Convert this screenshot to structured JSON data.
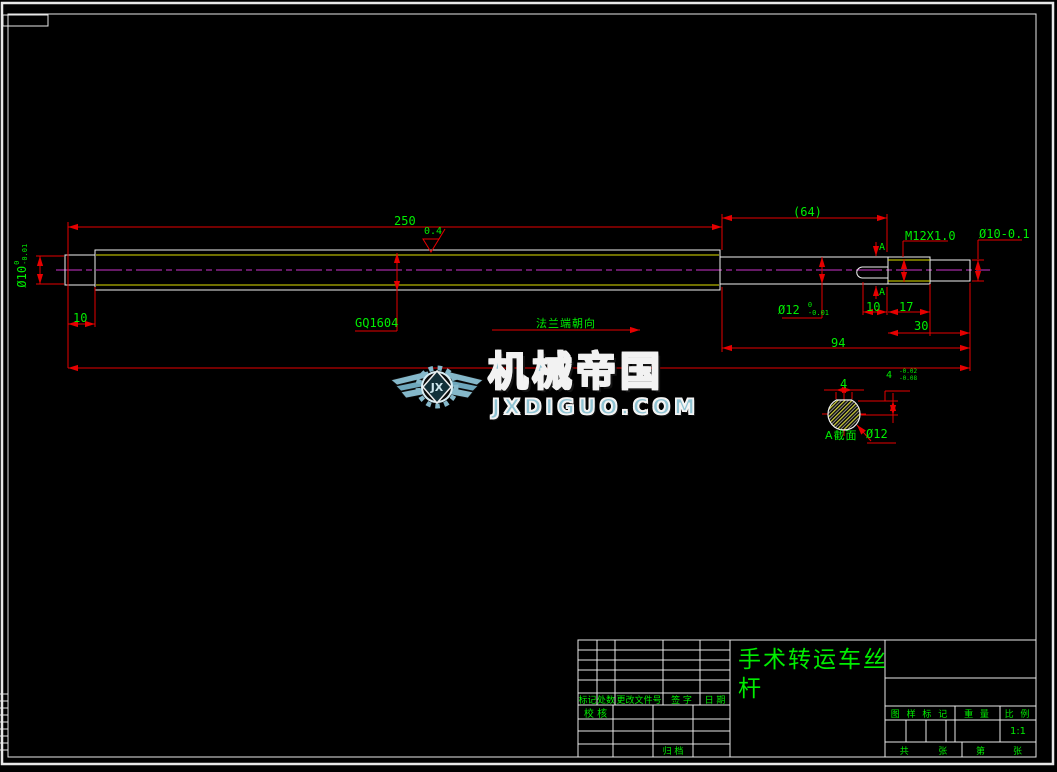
{
  "dims": {
    "len_250": "250",
    "len_64": "(64)",
    "roughness": "0.4",
    "thread": "M12X1.0",
    "dia10_end": "Ø10-0.1",
    "dia10_left": {
      "base": "Ø10",
      "upper": "0",
      "lower": "-0.01"
    },
    "dia12": {
      "base": "Ø12",
      "upper": "0",
      "lower": "-0.01"
    },
    "len_10_left": "10",
    "len_10_flat": "10",
    "len_17": "17",
    "len_30": "30",
    "len_94": "94",
    "screw_spec": "GQ1604",
    "flange_note": "法兰端朝向",
    "section_mark": "A",
    "flat_width": "4",
    "flat_tol": {
      "base": "4",
      "upper": "-0.02",
      "lower": "-0.08"
    },
    "section_name": "A截面",
    "section_dia": "Ø12"
  },
  "watermark": {
    "brand": "机械帝国",
    "site": "JXDIGUO.COM",
    "logo_initials": "JX",
    "accent_color": "#8fc3d3"
  },
  "title_block": {
    "title": "手术转运车丝杆",
    "rev_headers": [
      "标记",
      "处数",
      "更改文件号",
      "签 字",
      "日 期"
    ],
    "sig_check": "校 核",
    "sig_archive": "归 档",
    "stamp_header": "图 样 标 记",
    "weight_header": "重 量",
    "scale_header": "比 例",
    "scale_value": "1:1",
    "sheet_total_label": "共",
    "sheet_unit1": "张",
    "sheet_no_label": "第",
    "sheet_unit2": "张"
  },
  "colors": {
    "dimension_line": "#e60000",
    "annotation_text": "#00ee00",
    "outline": "#f0f0f0",
    "thread_line": "#e0e000",
    "centerline": "#cc33cc"
  }
}
